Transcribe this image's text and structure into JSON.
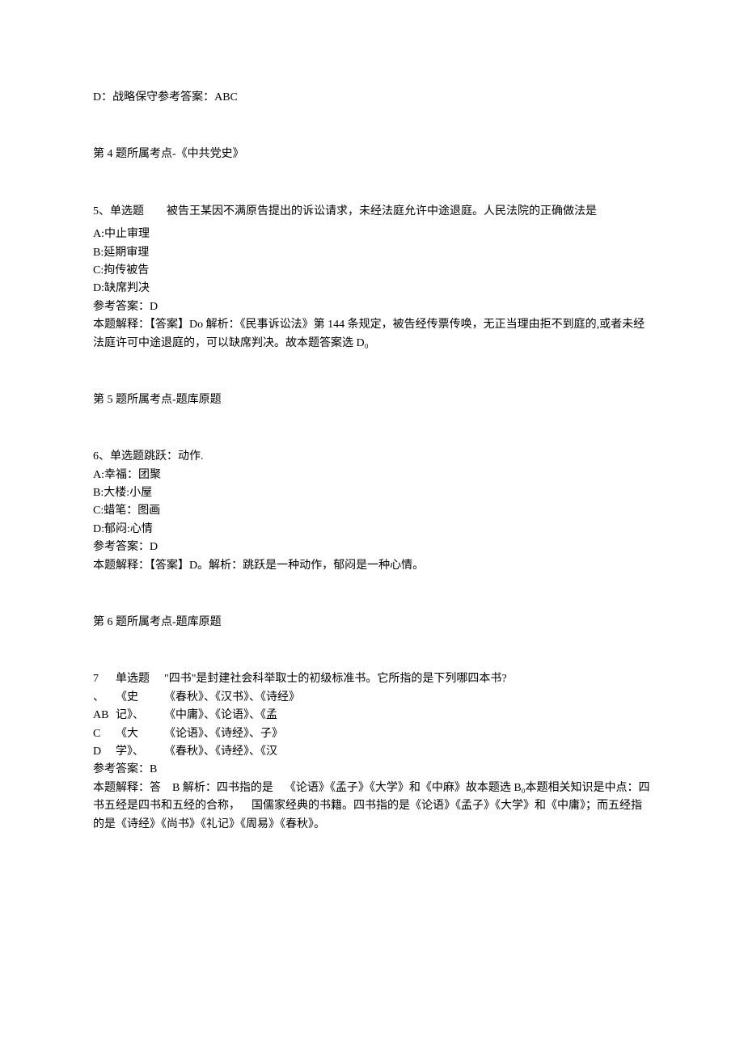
{
  "q4": {
    "optionD": "D：战略保守参考答案：ABC",
    "topic": "第 4 题所属考点-《中共党史》"
  },
  "q5": {
    "header": "5、单选题  被告王某因不满原告提出的诉讼请求，未经法庭允许中途退庭。人民法院的正确做法是",
    "optA": "A:中止审理",
    "optB": "B:延期审理",
    "optC": "C:拘传被告",
    "optD": "D:缺席判决",
    "ans": "参考答案：D",
    "expl": "本题解释：【答案】Do 解析：《民事诉讼法》第 144 条规定，被告经传票传唤，无正当理由拒不到庭的,或者未经法庭许可中途退庭的，可以缺席判决。故本题答案选 D₀",
    "topic": "第 5 题所属考点-题库原题"
  },
  "q6": {
    "header": "6、单选题跳跃：动作.",
    "optA": "A:幸福：团聚",
    "optB": "B:大楼:小屋",
    "optC": "C:蜡笔：图画",
    "optD": "D:郁闷:心情",
    "ans": "参考答案：D",
    "expl": "本题解释：【答案】D。解析：跳跃是一种动作，郁闷是一种心情。",
    "topic": "第 6 题所属考点-题库原题"
  },
  "q7": {
    "hdr_num": "7",
    "hdr_type": "单选题",
    "hdr_text": "\"四书\"是封建社会科举取士的初级标准书。它所指的是下列哪四本书?",
    "rowA_c1": "、",
    "rowA_c2": "《史",
    "rowA_c3": "《春秋》、《汉书》、《诗经》",
    "rowB_c1": "AB",
    "rowB_c2": "记》、",
    "rowB_c3": "《中庸》、《论语》、《孟",
    "rowC_c1": "C",
    "rowC_c2": "《大",
    "rowC_c3": "《论语》、《诗经》、子》",
    "rowD_c1": "D",
    "rowD_c2": "学》、",
    "rowD_c3": "《春秋》、《诗经》、《汉",
    "ans": "参考答案：B",
    "expl": "本题解释：答 B 解析：四书指的是 《论语》《孟子》《大学》和《中麻》故本题选 B₀本题相关知识是中点：四书五经是四书和五经的合称， 国儒家经典的书籍。四书指的是《论语》《孟子》《大学》和《中庸》；而五经指的是《诗经》《尚书》《礼记》《周易》《春秋》。"
  }
}
